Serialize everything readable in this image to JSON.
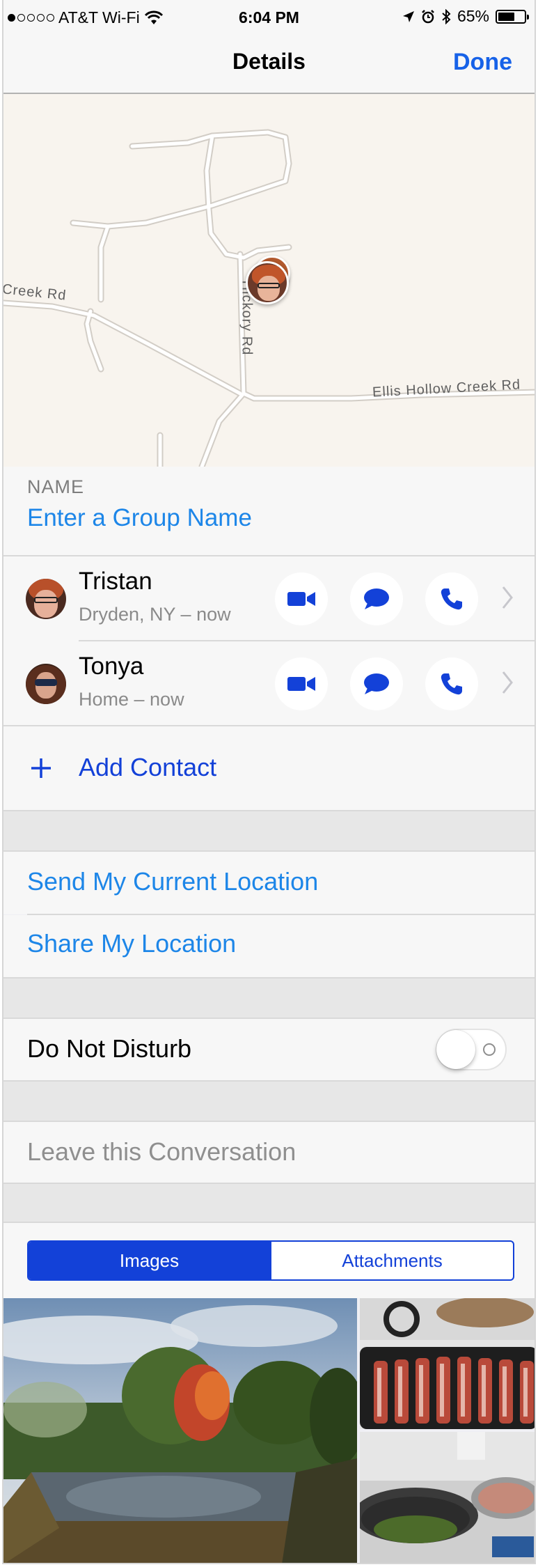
{
  "status_bar": {
    "carrier": "AT&T Wi-Fi",
    "time": "6:04 PM",
    "battery": "65%",
    "battery_level": 0.65,
    "signal_bars_filled": 1
  },
  "nav": {
    "title": "Details",
    "done_label": "Done"
  },
  "map": {
    "road_labels": [
      "Creek Rd",
      "Hickory Rd",
      "Ellis Hollow Creek Rd"
    ]
  },
  "group_name": {
    "header": "NAME",
    "placeholder_link": "Enter a Group Name"
  },
  "contacts": [
    {
      "name": "Tristan",
      "subtitle": "Dryden, NY – now"
    },
    {
      "name": "Tonya",
      "subtitle": "Home – now"
    }
  ],
  "add_contact_label": "Add Contact",
  "location": {
    "send_label": "Send My Current Location",
    "share_label": "Share My Location"
  },
  "dnd": {
    "label": "Do Not Disturb",
    "enabled": false
  },
  "leave_label": "Leave this Conversation",
  "segment": {
    "options": [
      "Images",
      "Attachments"
    ],
    "selected": "Images"
  },
  "colors": {
    "link": "#1d86e8",
    "accent": "#1341d8"
  }
}
